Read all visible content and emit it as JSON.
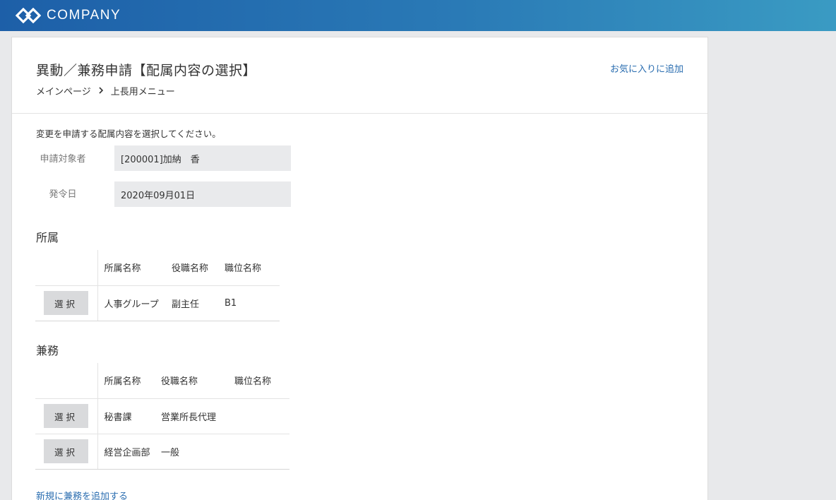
{
  "header": {
    "brand": "COMPANY",
    "logo_icon": "company-logo-icon",
    "colors": {
      "start": "#1d5fa8",
      "end": "#3a9bc3"
    }
  },
  "page": {
    "title": "異動／兼務申請【配属内容の選択】",
    "breadcrumb": {
      "home": "メインページ",
      "separator": "›",
      "current": "上長用メニュー"
    },
    "favorite_link": "お気に入りに追加",
    "instruction": "変更を申請する配属内容を選択してください。",
    "fields": {
      "applicant_label": "申請対象者",
      "applicant_value": "[200001]加納　香",
      "date_label": "発令日",
      "date_value": "2020年09月01日"
    }
  },
  "affiliation": {
    "title": "所属",
    "headers": [
      "所属名称",
      "役職名称",
      "職位名称"
    ],
    "select_label": "選択",
    "rows": [
      {
        "dept": "人事グループ",
        "position": "副主任",
        "grade": "B1"
      }
    ]
  },
  "concurrent": {
    "title": "兼務",
    "headers": [
      "所属名称",
      "役職名称",
      "職位名称"
    ],
    "select_label": "選択",
    "rows": [
      {
        "dept": "秘書課",
        "position": "営業所長代理",
        "grade": ""
      },
      {
        "dept": "経営企画部",
        "position": "一般",
        "grade": ""
      }
    ],
    "add_link": "新規に兼務を追加する"
  },
  "accent_link_color": "#2a6db0"
}
